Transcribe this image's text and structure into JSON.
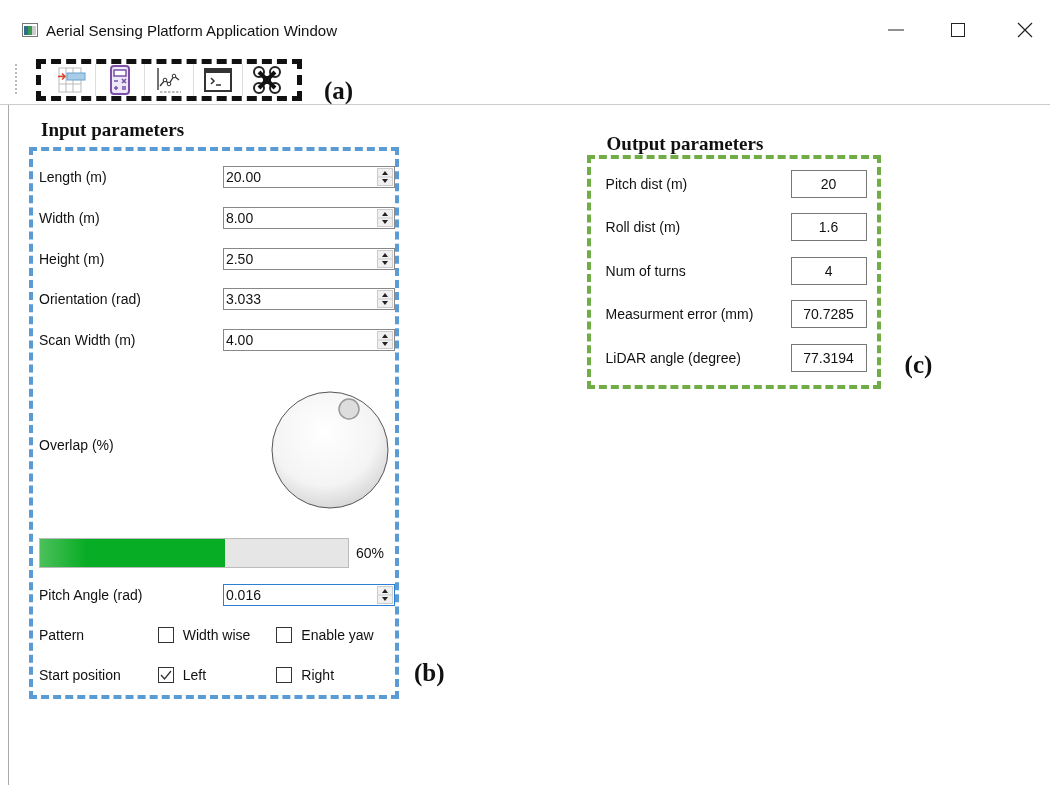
{
  "window": {
    "title": "Aerial Sensing Platform Application Window"
  },
  "toolbar": {
    "annotation": "(a)"
  },
  "input": {
    "heading": "Input parameters",
    "fields": [
      {
        "label": "Length (m)",
        "value": "20.00"
      },
      {
        "label": "Width (m)",
        "value": "8.00"
      },
      {
        "label": "Height (m)",
        "value": "2.50"
      },
      {
        "label": "Orientation (rad)",
        "value": "3.033"
      },
      {
        "label": "Scan Width (m)",
        "value": "4.00"
      }
    ],
    "overlap": {
      "label": "Overlap (%)"
    },
    "progress": {
      "level": 0.6,
      "text": "60%"
    },
    "pitch_angle": {
      "label": "Pitch Angle (rad)",
      "value": "0.016",
      "focused": true
    },
    "option_rows": [
      {
        "label": "Pattern",
        "options": [
          {
            "label": "Width wise",
            "checked": false
          },
          {
            "label": "Enable yaw",
            "checked": false
          }
        ]
      },
      {
        "label": "Start position",
        "options": [
          {
            "label": "Left",
            "checked": true
          },
          {
            "label": "Right",
            "checked": false
          }
        ]
      }
    ],
    "annotation": "(b)"
  },
  "output": {
    "heading": "Output parameters",
    "rows": [
      {
        "label": "Pitch dist (m)",
        "value": "20"
      },
      {
        "label": "Roll dist (m)",
        "value": "1.6"
      },
      {
        "label": "Num of turns",
        "value": "4"
      },
      {
        "label": "Measurment error (mm)",
        "value": "70.7285"
      },
      {
        "label": "LiDAR angle (degree)",
        "value": "77.3194"
      }
    ],
    "annotation": "(c)"
  }
}
